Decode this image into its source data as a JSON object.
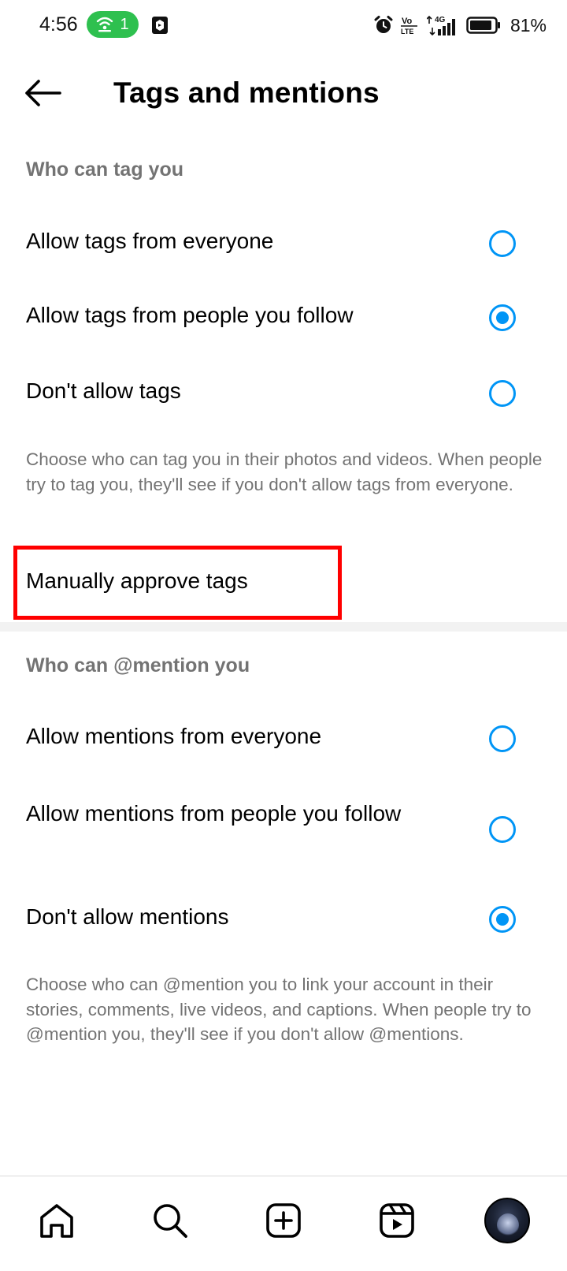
{
  "status_bar": {
    "time": "4:56",
    "hotspot_count": "1",
    "network": "4G",
    "volte": "Vo LTE",
    "battery_percent": "81%"
  },
  "header": {
    "title": "Tags and mentions",
    "back_icon": "arrow-left-icon"
  },
  "tags_section": {
    "heading": "Who can tag you",
    "options": [
      {
        "label": "Allow tags from everyone",
        "selected": false
      },
      {
        "label": "Allow tags from people you follow",
        "selected": true
      },
      {
        "label": "Don't allow tags",
        "selected": false
      }
    ],
    "description": "Choose who can tag you in their photos and videos. When people try to tag you, they'll see if you don't allow tags from everyone.",
    "manual_approve_label": "Manually approve tags"
  },
  "mentions_section": {
    "heading": "Who can @mention you",
    "options": [
      {
        "label": "Allow mentions from everyone",
        "selected": false
      },
      {
        "label": "Allow mentions from people you follow",
        "selected": false
      },
      {
        "label": "Don't allow mentions",
        "selected": true
      }
    ],
    "description": "Choose who can @mention you to link your account in their stories, comments, live videos, and captions. When people try to @mention you, they'll see if you don't allow @mentions."
  },
  "bottom_nav": {
    "items": [
      "home-icon",
      "search-icon",
      "create-icon",
      "reels-icon",
      "profile-avatar"
    ]
  },
  "colors": {
    "accent": "#0095f6",
    "secondary_text": "#737373",
    "highlight": "#ff0000",
    "hotspot": "#2ec04f"
  }
}
